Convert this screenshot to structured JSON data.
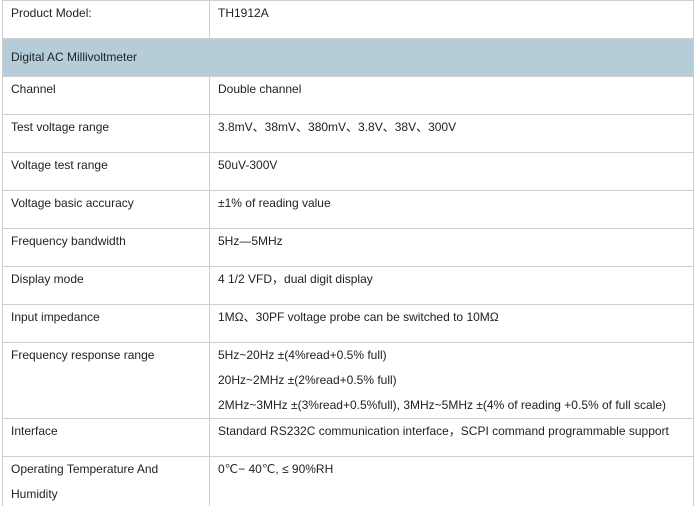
{
  "spec_table": {
    "model_label": "Product Model:",
    "model_value": "TH1912A",
    "section_title": "Digital AC Millivoltmeter",
    "rows": [
      {
        "label": "Channel",
        "values": [
          "Double channel"
        ]
      },
      {
        "label": "Test voltage range",
        "values": [
          "3.8mV、38mV、380mV、3.8V、38V、300V"
        ]
      },
      {
        "label": "Voltage test range",
        "values": [
          "50uV-300V"
        ]
      },
      {
        "label": "Voltage basic accuracy",
        "values": [
          "±1% of reading value"
        ]
      },
      {
        "label": "Frequency bandwidth",
        "values": [
          "5Hz—5MHz"
        ]
      },
      {
        "label": "Display mode",
        "values": [
          "4 1/2 VFD，dual digit display"
        ]
      },
      {
        "label": "Input impedance",
        "values": [
          "1MΩ、30PF voltage probe can be switched to 10MΩ"
        ]
      },
      {
        "label": "Frequency response range",
        "values": [
          "5Hz~20Hz ±(4%read+0.5% full)",
          "20Hz~2MHz ±(2%read+0.5% full)",
          "2MHz~3MHz ±(3%read+0.5%full), 3MHz~5MHz ±(4% of reading +0.5% of full scale)"
        ]
      },
      {
        "label": "Interface",
        "values": [
          "Standard RS232C communication interface，SCPI command programmable support"
        ]
      },
      {
        "label": "Operating Temperature And Humidity",
        "values": [
          "0℃− 40℃, ≤ 90%RH"
        ]
      }
    ]
  }
}
